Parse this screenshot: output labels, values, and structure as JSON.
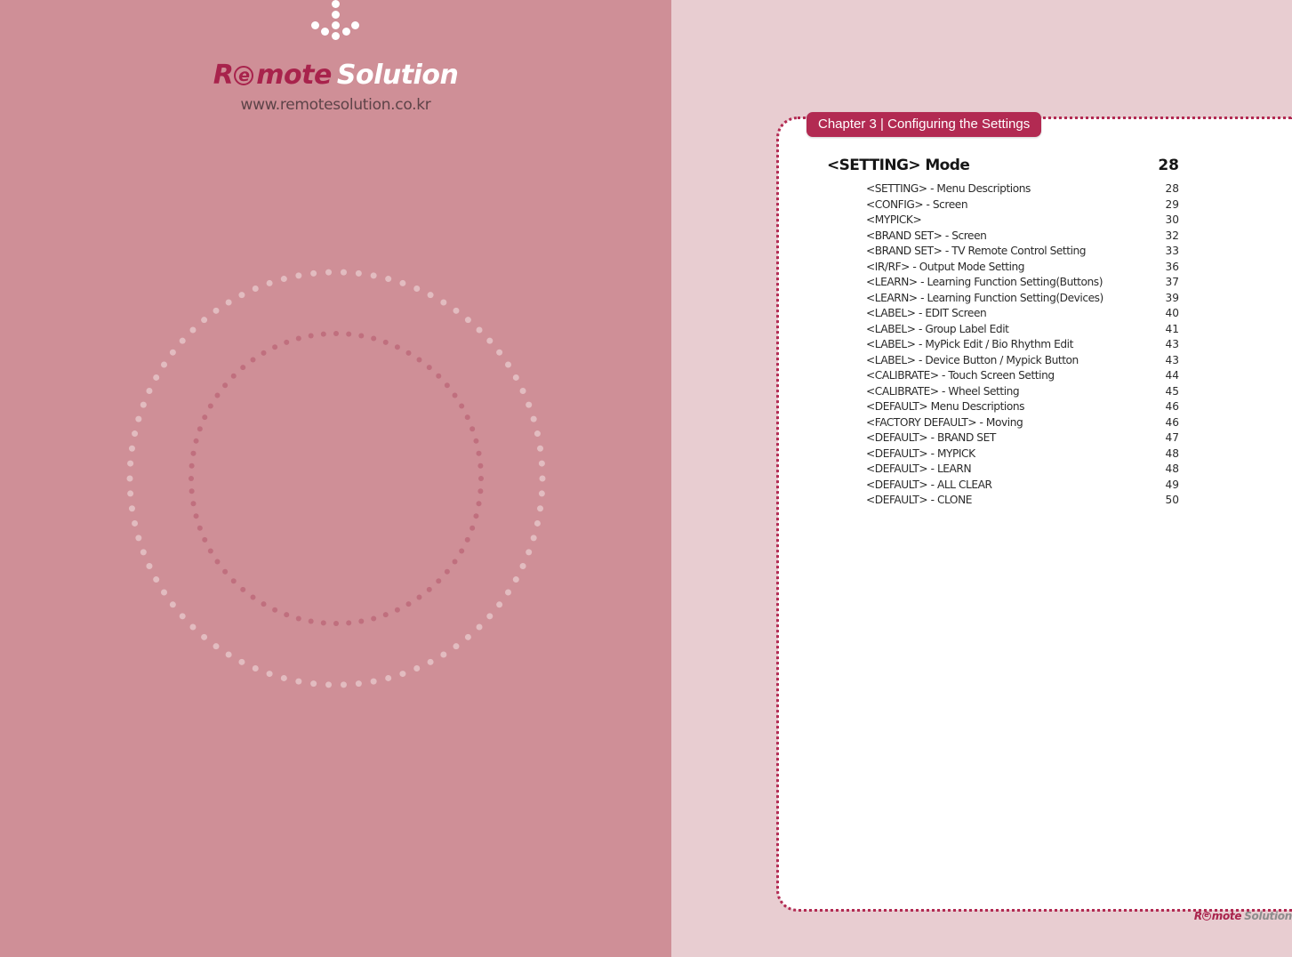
{
  "left_page": {
    "background_color": "#cf8f97",
    "logo": {
      "icon_name": "down-arrow-dots-icon",
      "word_r": "R",
      "word_e": "e",
      "word_mote": "mote",
      "word_solution": "Solution",
      "url": "www.remotesolution.co.kr"
    }
  },
  "right_page": {
    "background_color": "#e8cdd1",
    "accent_color": "#b22a52",
    "chapter_badge": "Chapter 3 | Configuring the Settings",
    "toc": {
      "heading": "<SETTING> Mode",
      "heading_page": "28",
      "entries": [
        {
          "label": "<SETTING> - Menu Descriptions",
          "page": "28"
        },
        {
          "label": "<CONFIG> - Screen",
          "page": "29"
        },
        {
          "label": "<MYPICK>",
          "page": "30"
        },
        {
          "label": "<BRAND SET> - Screen",
          "page": "32"
        },
        {
          "label": "<BRAND SET> - TV Remote Control Setting",
          "page": "33"
        },
        {
          "label": "<IR/RF> - Output Mode Setting",
          "page": "36"
        },
        {
          "label": "<LEARN> - Learning Function Setting(Buttons)",
          "page": "37"
        },
        {
          "label": "<LEARN> - Learning Function Setting(Devices)",
          "page": "39"
        },
        {
          "label": "<LABEL> - EDIT Screen",
          "page": "40"
        },
        {
          "label": "<LABEL> - Group Label Edit",
          "page": "41"
        },
        {
          "label": "<LABEL> - MyPick Edit / Bio Rhythm Edit",
          "page": "43"
        },
        {
          "label": "<LABEL> - Device Button / Mypick Button",
          "page": "43"
        },
        {
          "label": "<CALIBRATE> - Touch Screen Setting",
          "page": "44"
        },
        {
          "label": "<CALIBRATE> - Wheel Setting",
          "page": "45"
        },
        {
          "label": "<DEFAULT> Menu Descriptions",
          "page": "46"
        },
        {
          "label": "<FACTORY DEFAULT> - Moving",
          "page": "46"
        },
        {
          "label": "<DEFAULT> - BRAND SET",
          "page": "47"
        },
        {
          "label": "<DEFAULT> - MYPICK",
          "page": "48"
        },
        {
          "label": "<DEFAULT> - LEARN",
          "page": "48"
        },
        {
          "label": "<DEFAULT> - ALL CLEAR",
          "page": "49"
        },
        {
          "label": "<DEFAULT> - CLONE",
          "page": "50"
        }
      ]
    },
    "footer_logo": {
      "word_r": "R",
      "word_e": "e",
      "word_mote": "mote",
      "word_solution": "Solution"
    }
  }
}
